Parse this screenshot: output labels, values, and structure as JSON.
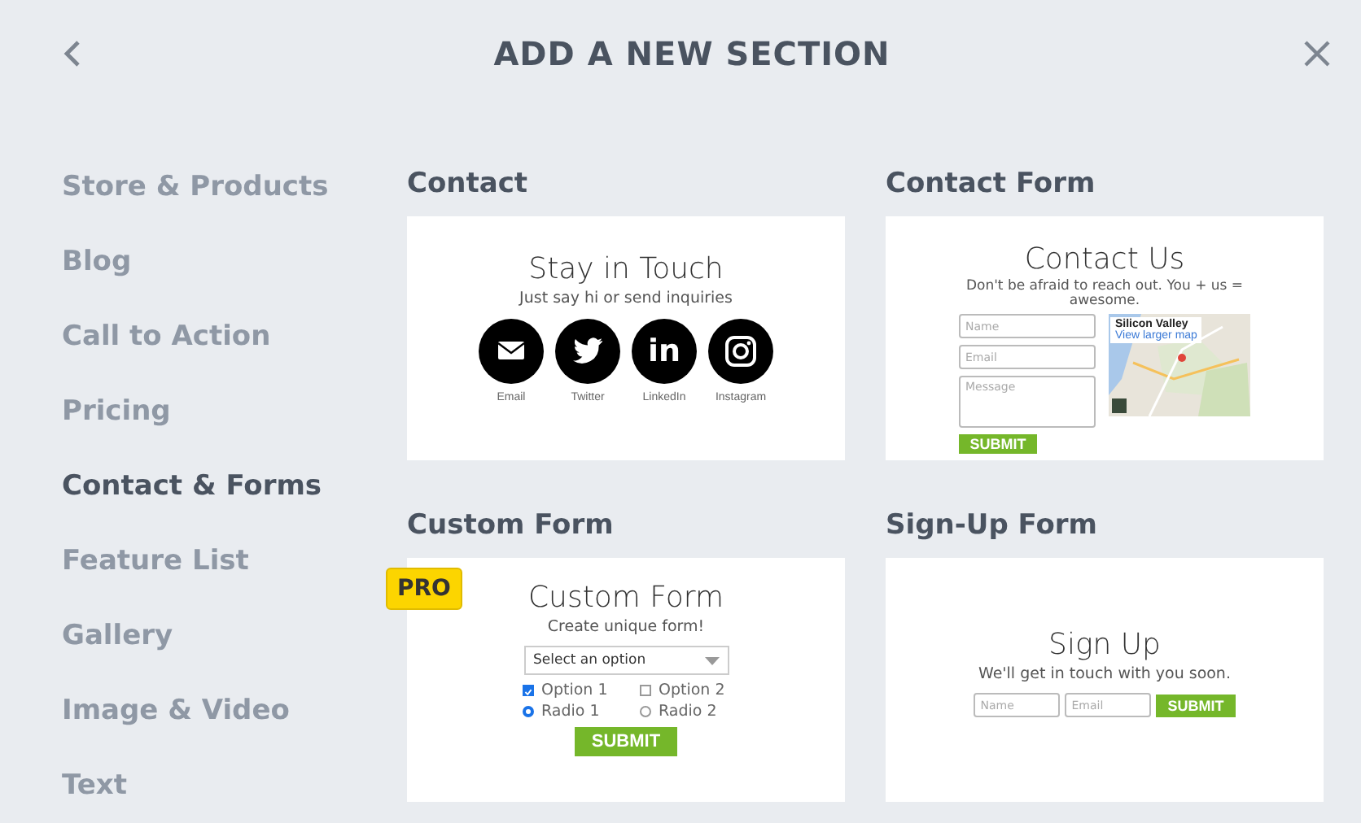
{
  "header": {
    "title": "ADD A NEW SECTION"
  },
  "sidebar": {
    "items": [
      {
        "label": "Store & Products",
        "selected": false
      },
      {
        "label": "Blog",
        "selected": false
      },
      {
        "label": "Call to Action",
        "selected": false
      },
      {
        "label": "Pricing",
        "selected": false
      },
      {
        "label": "Contact & Forms",
        "selected": true
      },
      {
        "label": "Feature List",
        "selected": false
      },
      {
        "label": "Gallery",
        "selected": false
      },
      {
        "label": "Image & Video",
        "selected": false
      },
      {
        "label": "Text",
        "selected": false
      }
    ]
  },
  "sections": [
    {
      "title": "Contact",
      "kind": "contact",
      "preview": {
        "heading": "Stay in Touch",
        "subheading": "Just say hi or send inquiries",
        "socials": [
          {
            "kind": "email",
            "label": "Email"
          },
          {
            "kind": "twitter",
            "label": "Twitter"
          },
          {
            "kind": "linkedin",
            "label": "LinkedIn",
            "glyph": "in"
          },
          {
            "kind": "instagram",
            "label": "Instagram"
          }
        ]
      }
    },
    {
      "title": "Contact Form",
      "kind": "contact_form",
      "preview": {
        "heading": "Contact Us",
        "subheading": "Don't be afraid to reach out. You + us = awesome.",
        "fields": [
          {
            "kind": "input",
            "placeholder": "Name"
          },
          {
            "kind": "input",
            "placeholder": "Email"
          },
          {
            "kind": "textarea",
            "placeholder": "Message"
          }
        ],
        "submit": "SUBMIT",
        "map": {
          "place": "Silicon Valley",
          "link": "View larger map"
        }
      }
    },
    {
      "title": "Custom Form",
      "kind": "custom_form",
      "badge": "PRO",
      "preview": {
        "heading": "Custom Form",
        "subheading": "Create unique form!",
        "select": "Select an option",
        "options": [
          {
            "kind": "checkbox",
            "label": "Option 1",
            "checked": true
          },
          {
            "kind": "checkbox",
            "label": "Option 2",
            "checked": false
          },
          {
            "kind": "radio",
            "label": "Radio 1",
            "checked": true
          },
          {
            "kind": "radio",
            "label": "Radio 2",
            "checked": false
          }
        ],
        "submit": "SUBMIT"
      }
    },
    {
      "title": "Sign-Up Form",
      "kind": "signup",
      "preview": {
        "heading": "Sign Up",
        "subheading": "We'll get in touch with you soon.",
        "fields": [
          {
            "kind": "input",
            "placeholder": "Name"
          },
          {
            "kind": "input",
            "placeholder": "Email"
          }
        ],
        "submit": "SUBMIT"
      }
    }
  ]
}
